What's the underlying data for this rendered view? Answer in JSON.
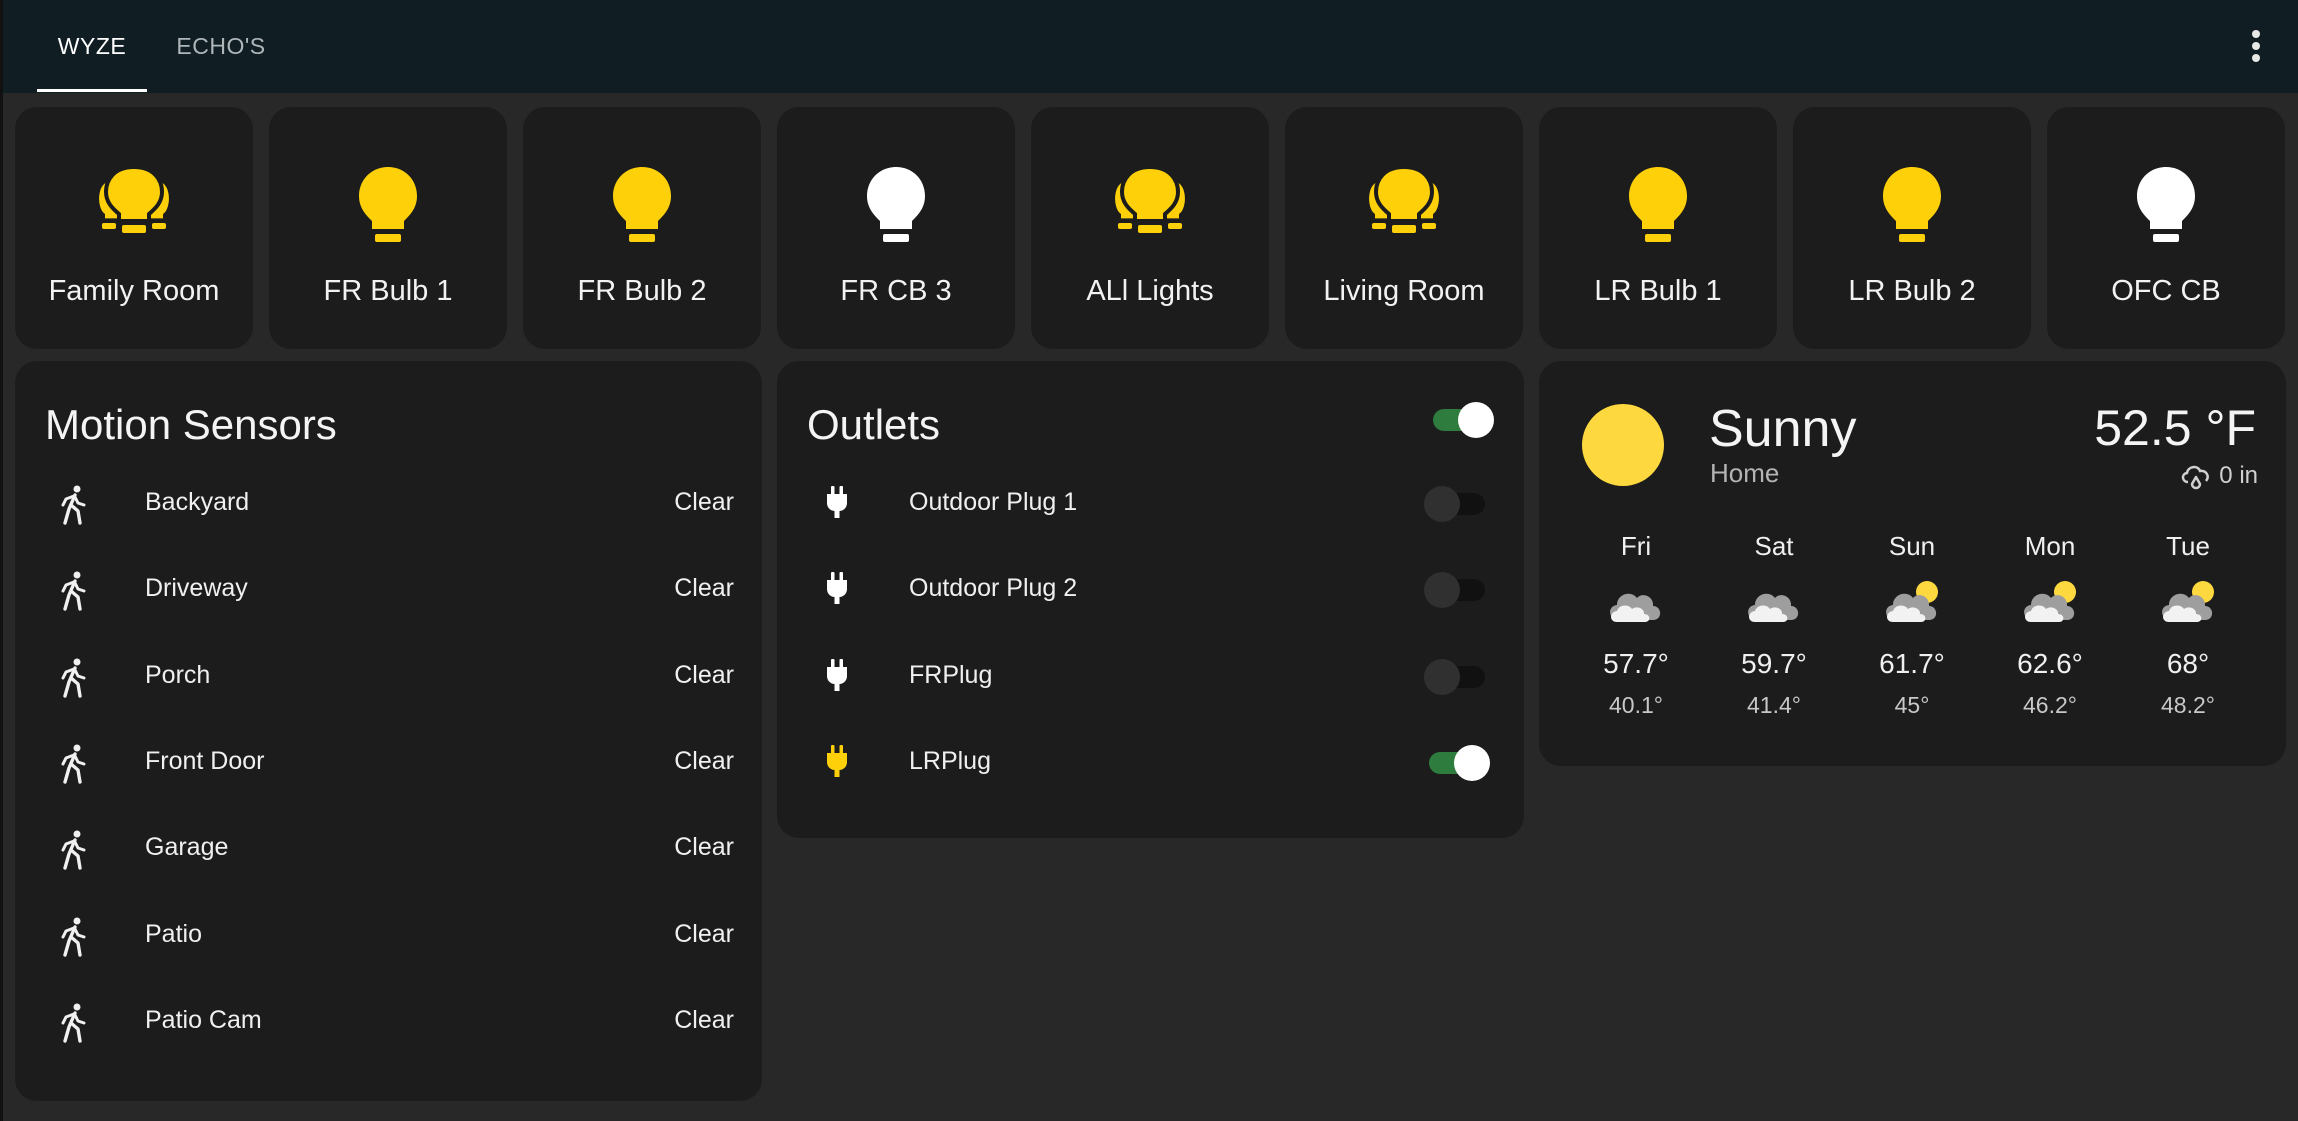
{
  "tabs": [
    {
      "label": "WYZE",
      "active": true
    },
    {
      "label": "ECHO'S",
      "active": false
    }
  ],
  "lights": [
    {
      "name": "Family Room",
      "icon": "lightbulb-group-icon",
      "on": true
    },
    {
      "name": "FR Bulb 1",
      "icon": "lightbulb-icon",
      "on": true
    },
    {
      "name": "FR Bulb 2",
      "icon": "lightbulb-icon",
      "on": true
    },
    {
      "name": "FR CB 3",
      "icon": "lightbulb-icon",
      "on": false
    },
    {
      "name": "ALl Lights",
      "icon": "lightbulb-group-icon",
      "on": true
    },
    {
      "name": "Living Room",
      "icon": "lightbulb-group-icon",
      "on": true
    },
    {
      "name": "LR Bulb 1",
      "icon": "lightbulb-icon",
      "on": true
    },
    {
      "name": "LR Bulb 2",
      "icon": "lightbulb-icon",
      "on": true
    },
    {
      "name": "OFC CB",
      "icon": "lightbulb-icon",
      "on": false
    }
  ],
  "motion": {
    "title": "Motion Sensors",
    "sensors": [
      {
        "name": "Backyard",
        "state": "Clear"
      },
      {
        "name": "Driveway",
        "state": "Clear"
      },
      {
        "name": "Porch",
        "state": "Clear"
      },
      {
        "name": "Front Door",
        "state": "Clear"
      },
      {
        "name": "Garage",
        "state": "Clear"
      },
      {
        "name": "Patio",
        "state": "Clear"
      },
      {
        "name": "Patio Cam",
        "state": "Clear"
      }
    ]
  },
  "outlets": {
    "title": "Outlets",
    "master_on": true,
    "items": [
      {
        "name": "Outdoor Plug 1",
        "on": false
      },
      {
        "name": "Outdoor Plug 2",
        "on": false
      },
      {
        "name": "FRPlug",
        "on": false
      },
      {
        "name": "LRPlug",
        "on": true
      }
    ]
  },
  "weather": {
    "condition": "Sunny",
    "location": "Home",
    "temperature": "52.5 °F",
    "precipitation": "0 in",
    "forecast": [
      {
        "day": "Fri",
        "icon": "cloudy-icon",
        "high": "57.7°",
        "low": "40.1°"
      },
      {
        "day": "Sat",
        "icon": "cloudy-icon",
        "high": "59.7°",
        "low": "41.4°"
      },
      {
        "day": "Sun",
        "icon": "partly-cloudy-icon",
        "high": "61.7°",
        "low": "45°"
      },
      {
        "day": "Mon",
        "icon": "partly-cloudy-icon",
        "high": "62.6°",
        "low": "46.2°"
      },
      {
        "day": "Tue",
        "icon": "partly-cloudy-icon",
        "high": "68°",
        "low": "48.2°"
      }
    ]
  },
  "colors": {
    "light_on": "#fdd00a",
    "light_off": "#ffffff",
    "toggle_on": "#2e7d3e",
    "sun": "#fdd83f",
    "card": "#1c1c1c",
    "header": "#101e24"
  }
}
